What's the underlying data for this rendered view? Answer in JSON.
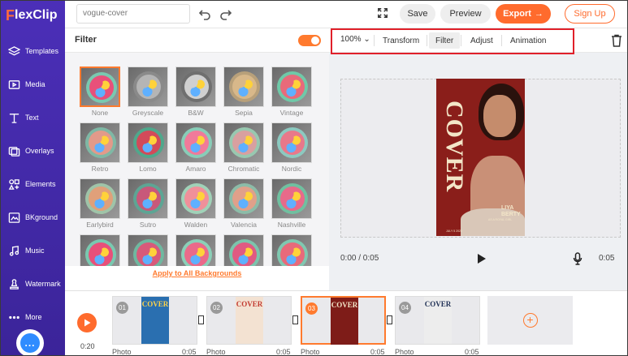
{
  "app": {
    "brand_first": "F",
    "brand_rest": "lexClip"
  },
  "sidebar": {
    "items": [
      {
        "label": "Templates",
        "icon": "layers-icon"
      },
      {
        "label": "Media",
        "icon": "media-folder-icon"
      },
      {
        "label": "Text",
        "icon": "text-icon"
      },
      {
        "label": "Overlays",
        "icon": "overlays-icon"
      },
      {
        "label": "Elements",
        "icon": "elements-icon"
      },
      {
        "label": "BKground",
        "icon": "background-icon"
      },
      {
        "label": "Music",
        "icon": "music-icon"
      },
      {
        "label": "Watermark",
        "icon": "watermark-icon"
      },
      {
        "label": "More",
        "icon": "more-dots-icon"
      }
    ],
    "chat_label": "..."
  },
  "topbar": {
    "project_name": "vogue-cover",
    "save_label": "Save",
    "preview_label": "Preview",
    "export_label": "Export",
    "export_arrow": "→",
    "signup_label": "Sign Up"
  },
  "filter_panel": {
    "title": "Filter",
    "toggle_on": true,
    "apply_all_label": "Apply to All Backgrounds",
    "filters": [
      {
        "label": "None",
        "selected": true,
        "tint": "#79c9b0",
        "candy": "#e8507a"
      },
      {
        "label": "Greyscale",
        "tint": "#8a8a8a",
        "candy": "#b5b5b5"
      },
      {
        "label": "B&W",
        "tint": "#6f6f6f",
        "candy": "#d0d0d0"
      },
      {
        "label": "Sepia",
        "tint": "#b8a07a",
        "candy": "#d8b88a"
      },
      {
        "label": "Vintage",
        "tint": "#6fc9a8",
        "candy": "#e86a7a"
      },
      {
        "label": "Retro",
        "tint": "#7fb8a5",
        "candy": "#e29a8a"
      },
      {
        "label": "Lomo",
        "tint": "#4fa88c",
        "candy": "#d24a5a"
      },
      {
        "label": "Amaro",
        "tint": "#88cdb8",
        "candy": "#f07a9a"
      },
      {
        "label": "Chromatic",
        "tint": "#98c8b0",
        "candy": "#d8a0a0"
      },
      {
        "label": "Nordic",
        "tint": "#8cc9c0",
        "candy": "#e8788a"
      },
      {
        "label": "Earlybird",
        "tint": "#9fc4a8",
        "candy": "#e0a07a"
      },
      {
        "label": "Sutro",
        "tint": "#5da594",
        "candy": "#c8587a"
      },
      {
        "label": "Walden",
        "tint": "#a0d2b8",
        "candy": "#f0909a"
      },
      {
        "label": "Valencia",
        "tint": "#8cbca8",
        "candy": "#e0a08a"
      },
      {
        "label": "Nashville",
        "tint": "#70c0a0",
        "candy": "#e86a8a"
      },
      {
        "label": "",
        "tint": "#79c9b0",
        "candy": "#e8507a"
      },
      {
        "label": "",
        "tint": "#6fb8a0",
        "candy": "#d85a7a"
      },
      {
        "label": "",
        "tint": "#8ad0b8",
        "candy": "#ea6a8a"
      },
      {
        "label": "",
        "tint": "#7cc4ac",
        "candy": "#e05a82"
      },
      {
        "label": "",
        "tint": "#80c8b0",
        "candy": "#e86a7a"
      }
    ]
  },
  "toolbar": {
    "zoom": "100%",
    "tabs": [
      "Transform",
      "Filter",
      "Adjust",
      "Animation"
    ],
    "active_tab": "Filter"
  },
  "poster": {
    "word": "COVER",
    "name_line1": "LIYA",
    "name_line2": "BERTY",
    "date": "JULY 5 2022",
    "tag": "AS A ROYAL GIRL"
  },
  "player": {
    "current": "0:00 / 0:05",
    "duration": "0:05"
  },
  "timeline": {
    "total": "0:20",
    "clips": [
      {
        "num": "01",
        "type": "Photo",
        "dur": "0:05",
        "thumb_color": "#2a6fb0",
        "accent": "#ffd24a",
        "word": "COVER"
      },
      {
        "num": "02",
        "type": "Photo",
        "dur": "0:05",
        "thumb_color": "#f3e2d2",
        "accent": "#c23a30",
        "word": "COVER"
      },
      {
        "num": "03",
        "type": "Photo",
        "dur": "0:05",
        "thumb_color": "#7e1c18",
        "accent": "#f3e6c8",
        "word": "COVER"
      },
      {
        "num": "04",
        "type": "Photo",
        "dur": "0:05",
        "thumb_color": "#ededed",
        "accent": "#1f2f55",
        "word": "COVER"
      }
    ]
  },
  "colors": {
    "accent": "#ff6b2d",
    "sidebar": "#4b2fb8",
    "highlight_box": "#e0202a"
  }
}
